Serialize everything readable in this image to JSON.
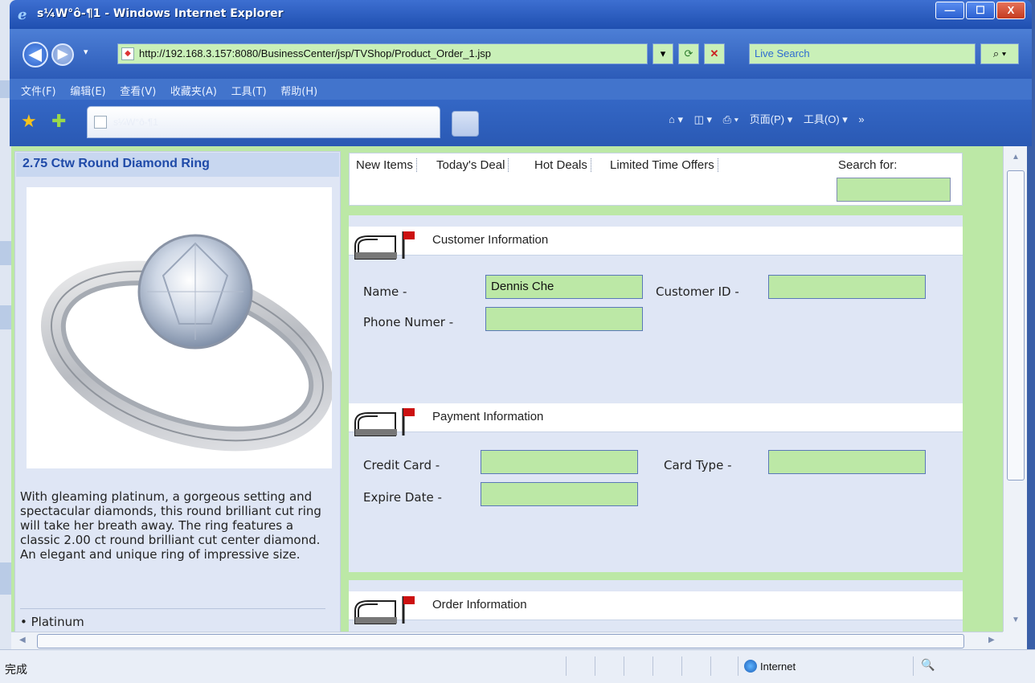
{
  "window": {
    "title": "s¼W°ô-¶1 - Windows Internet Explorer",
    "minimize": "—",
    "maximize": "☐",
    "close": "X"
  },
  "nav": {
    "back": "◀",
    "forward": "▶",
    "address": "http://192.168.3.157:8080/BusinessCenter/jsp/TVShop/Product_Order_1.jsp",
    "dropdown": "▾",
    "refresh": "⟳",
    "stop": "✕",
    "search_placeholder": "Live Search",
    "search_go": "⌕ ▾"
  },
  "menu": [
    "文件(F)",
    "编辑(E)",
    "查看(V)",
    "收藏夹(A)",
    "工具(T)",
    "帮助(H)"
  ],
  "tab": {
    "title": "s¼W°ô-¶1"
  },
  "command_bar": {
    "home": "⌂ ▾",
    "feeds": "◫ ▾",
    "print": "⎙ ▾",
    "page": "页面(P) ▾",
    "tools": "工具(O) ▾",
    "more": "»"
  },
  "product": {
    "title": "2.75 Ctw Round Diamond Ring",
    "description": "With gleaming platinum, a gorgeous setting and spectacular diamonds, this round brilliant cut ring will take her breath away. The ring features a classic 2.00 ct round brilliant cut center diamond. An elegant and unique ring of impressive size.",
    "bullet": "• Platinum"
  },
  "links": [
    "New Items",
    "Today's Deal",
    "Hot Deals",
    "Limited Time Offers"
  ],
  "search_for_label": "Search for:",
  "sections": {
    "customer": {
      "title": "Customer Information",
      "name_label": "Name -",
      "name_value": "Dennis Che",
      "customer_id_label": "Customer ID -",
      "customer_id_value": "",
      "phone_label": "Phone Numer -",
      "phone_value": ""
    },
    "payment": {
      "title": "Payment Information",
      "credit_card_label": "Credit Card -",
      "credit_card_value": "",
      "card_type_label": "Card Type -",
      "card_type_value": "",
      "expire_label": "Expire Date -",
      "expire_value": ""
    },
    "order": {
      "title": "Order Information"
    }
  },
  "status": {
    "text": "完成",
    "zone": "Internet",
    "zoom_icon": "🔍"
  },
  "colors": {
    "field_bg": "#bce8a6",
    "panel_bg": "#dfe6f5",
    "title_blue": "#1f4aa8"
  }
}
